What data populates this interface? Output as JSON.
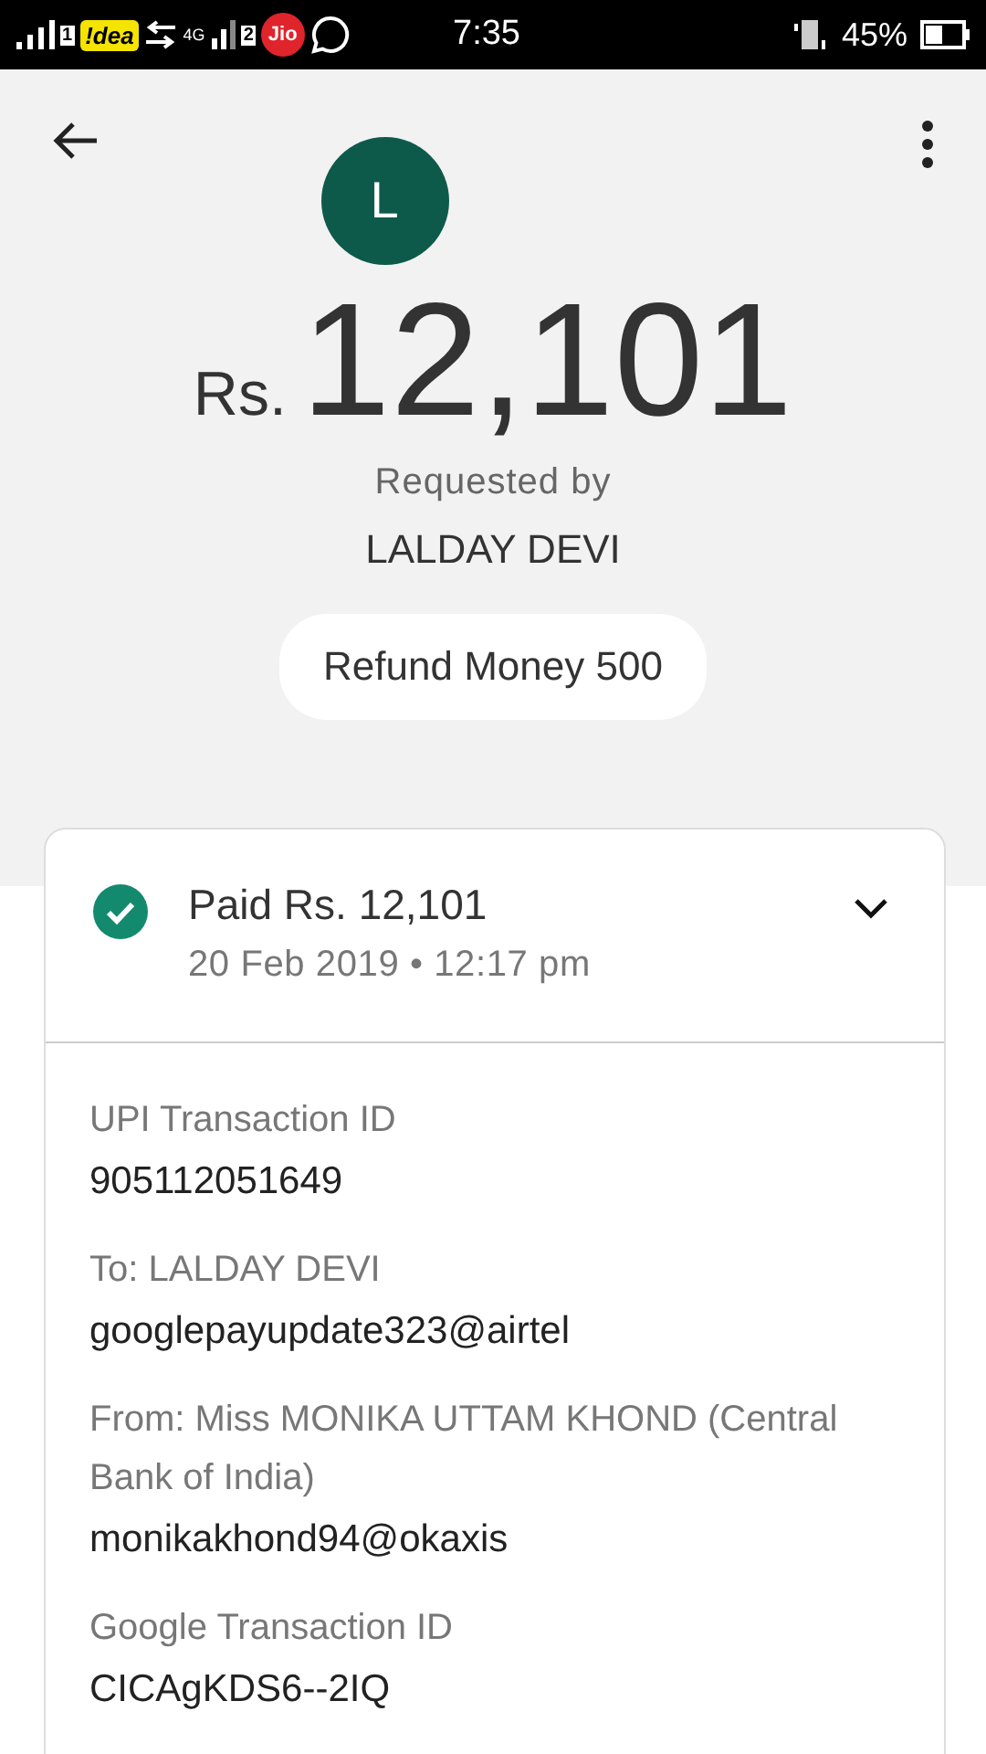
{
  "status_bar": {
    "sim1": "1",
    "carrier1": "!dea",
    "network": "4G",
    "sim2": "2",
    "carrier2": "Jio",
    "time": "7:35",
    "battery": "45%"
  },
  "header": {
    "avatar": "L",
    "currency": "Rs.",
    "amount": "12,101",
    "requested_label": "Requested by",
    "requester": "LALDAY DEVI",
    "note": "Refund Money 500"
  },
  "card": {
    "status": "Paid Rs. 12,101",
    "date": "20 Feb 2019 • 12:17 pm",
    "expanded": false,
    "details": [
      {
        "label": "UPI Transaction ID",
        "value": "905112051649"
      },
      {
        "label": "To: LALDAY DEVI",
        "value": "googlepayupdate323@airtel"
      },
      {
        "label": "From: Miss MONIKA UTTAM KHOND (Central Bank of India)",
        "value": "monikakhond94@okaxis"
      },
      {
        "label": "Google Transaction ID",
        "value": "CICAgKDS6--2IQ"
      }
    ]
  }
}
